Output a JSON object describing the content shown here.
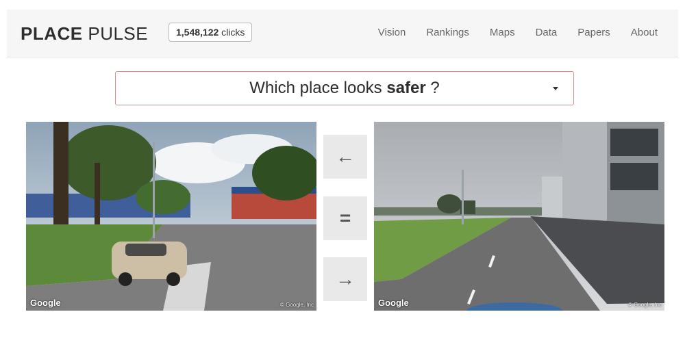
{
  "header": {
    "brand_bold": "PLACE",
    "brand_light": " PULSE",
    "clicks_count": "1,548,122",
    "clicks_label": " clicks",
    "nav": [
      "Vision",
      "Rankings",
      "Maps",
      "Data",
      "Papers",
      "About"
    ]
  },
  "question": {
    "prefix": "Which place looks ",
    "attribute": "safer",
    "suffix": " ?"
  },
  "images": {
    "left_logo": "Google",
    "left_copyright": "© Google, Inc",
    "right_logo": "Google",
    "right_copyright": "© Google, Inc"
  },
  "vote_buttons": {
    "left": "←",
    "equal": "=",
    "right": "→"
  },
  "colors": {
    "navbar_bg": "#f6f6f6",
    "question_border": "#e08a8a",
    "button_bg": "#e9e9e9"
  }
}
